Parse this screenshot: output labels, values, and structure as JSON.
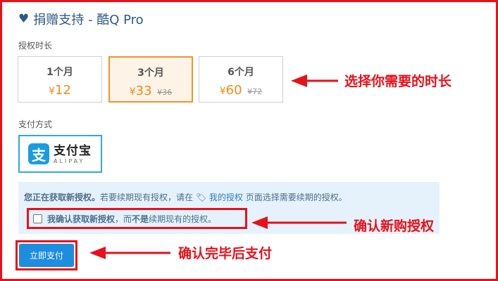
{
  "header": {
    "title": "捐赠支持 - 酷Q Pro",
    "icon": "heart-icon"
  },
  "duration": {
    "label": "授权时长",
    "plans": [
      {
        "name": "1个月",
        "currency": "¥",
        "price": "12",
        "old_price": "",
        "selected": false
      },
      {
        "name": "3个月",
        "currency": "¥",
        "price": "33",
        "old_price": "¥36",
        "selected": true
      },
      {
        "name": "6个月",
        "currency": "¥",
        "price": "60",
        "old_price": "¥72",
        "selected": false
      }
    ]
  },
  "payment": {
    "label": "支付方式",
    "alipay_logo_glyph": "支",
    "alipay_cn": "支付宝",
    "alipay_en": "ALIPAY"
  },
  "notice": {
    "bold_intro": "您正在获取新授权。",
    "text_before_link": "若要续期现有授权，请在",
    "link_icon": "tag-icon",
    "link_text": "我的授权",
    "text_after_link": "页面选择需要续期的授权。"
  },
  "confirm": {
    "checked": false,
    "part1": "我确认",
    "part1_bold": "获取新授权",
    "part2": "，而",
    "part2_bold": "不是",
    "part3": "续期现有的授权。"
  },
  "pay_button": {
    "label": "立即支付"
  },
  "annotations": {
    "a1": "选择你需要的时长",
    "a2": "确认新购授权",
    "a3": "确认完毕后支付"
  },
  "colors": {
    "accent_red": "#e8101a",
    "brand_blue": "#1d8de0",
    "price_orange": "#f08c1a"
  }
}
